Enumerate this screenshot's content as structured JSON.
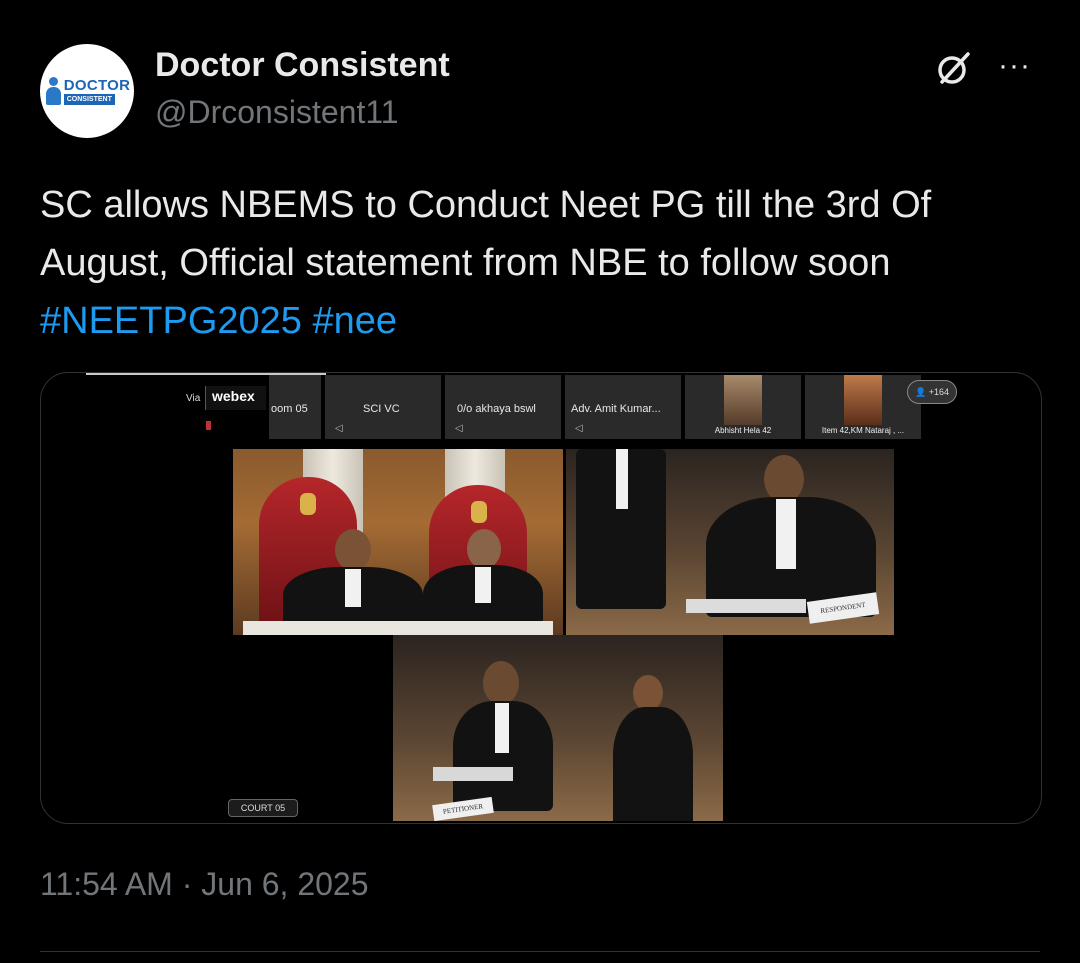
{
  "author": {
    "name": "Doctor Consistent",
    "handle": "@Drconsistent11",
    "avatar_text_top": "DOCTOR",
    "avatar_text_bottom": "CONSISTENT"
  },
  "icons": {
    "grok": "grok-icon",
    "more": "more-icon"
  },
  "post": {
    "line1": "SC allows NBEMS to Conduct Neet PG till the 3rd Of",
    "line2": "August, Official statement from NBE to follow soon",
    "hashtag1": "#NEETPG2025",
    "hashtag2": "#nee",
    "timestamp": "11:54 AM · Jun 6, 2025"
  },
  "media": {
    "via_label": "Via",
    "app_name": "webex",
    "participant_tiles": [
      {
        "label": "oom 05"
      },
      {
        "label": "SCI VC"
      },
      {
        "label": "0/o akhaya bswl"
      },
      {
        "label": "Adv. Amit Kumar..."
      },
      {
        "label": "Abhisht Hela 42"
      },
      {
        "label": "Item 42,KM Nataraj , ..."
      }
    ],
    "participant_count": "+164",
    "court_label": "COURT 05",
    "respondent_sign": "RESPONDENT",
    "petitioner_sign": "PETITIONER"
  },
  "colors": {
    "background": "#000000",
    "text": "#e7e9ea",
    "secondary": "#71767b",
    "hashtag": "#1d9bf0",
    "border": "#2f3336"
  }
}
